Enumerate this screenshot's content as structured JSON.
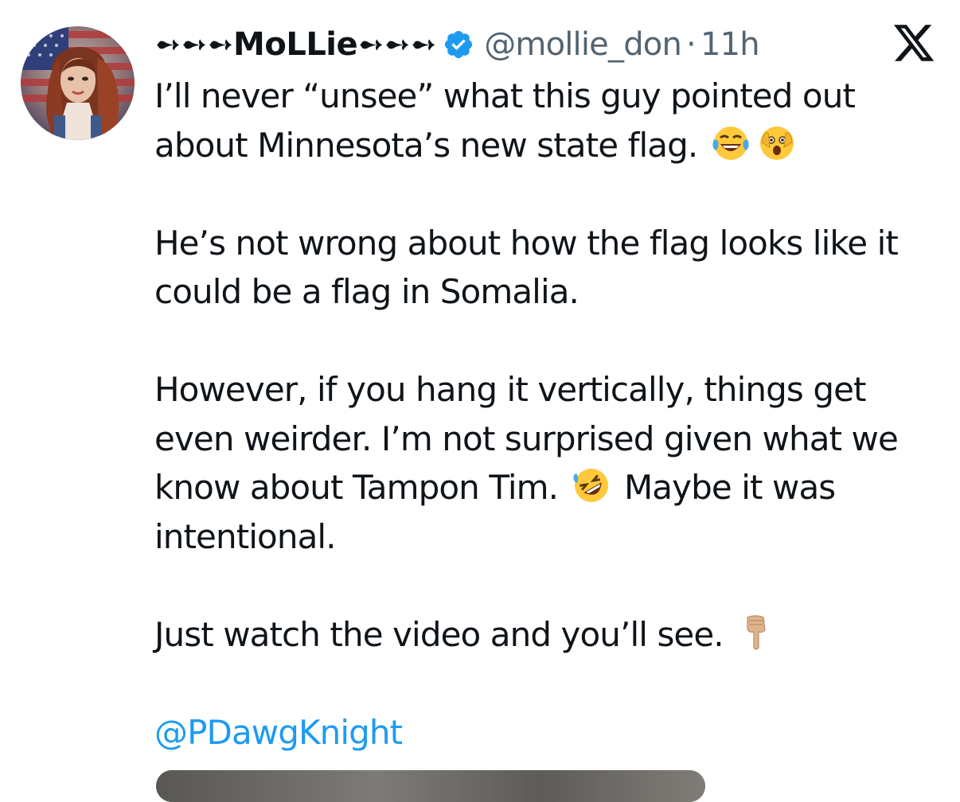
{
  "tweet": {
    "author": {
      "display_name": "➻➻➻MoLLie➻➻➻",
      "handle": "@mollie_don",
      "separator": "·",
      "time": "11h",
      "verified": true,
      "avatar_icon": "avatar-photo"
    },
    "platform_logo": "x-logo-icon",
    "paragraphs": [
      {
        "lines": [
          "I’ll never “unsee” what this guy pointed out",
          "about Minnesota’s new state flag."
        ],
        "emojis": [
          "face-with-tears-of-joy",
          "face-with-open-eyes-and-hand-over-mouth"
        ]
      },
      {
        "lines": [
          "He’s not wrong about how the flag looks like it",
          "could be a flag in Somalia."
        ]
      },
      {
        "lines": [
          "However, if you hang it vertically, things get",
          "even weirder. I’m not surprised given what we",
          "know about Tampon Tim.",
          "Maybe it was",
          "intentional."
        ],
        "emojis": [
          "rolling-on-the-floor-laughing"
        ]
      },
      {
        "lines": [
          "Just watch the video and you’ll see."
        ],
        "emojis": [
          "backhand-index-pointing-down"
        ]
      }
    ],
    "mention": "@PDawgKnight",
    "colors": {
      "text": "#0f1419",
      "secondary": "#536471",
      "link": "#1d9bf0",
      "verified": "#1d9bf0"
    }
  }
}
